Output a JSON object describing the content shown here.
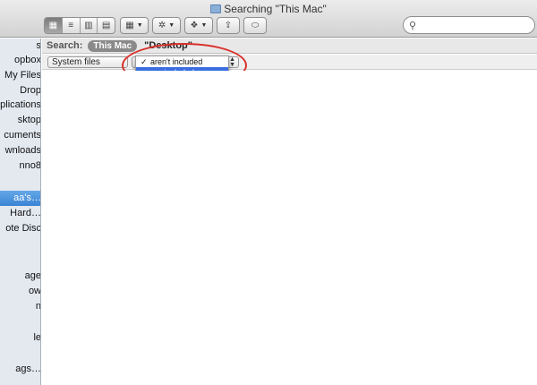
{
  "window": {
    "title": "Searching \"This Mac\""
  },
  "toolbar": {
    "view_buttons": [
      "icon-view",
      "list-view",
      "column-view",
      "coverflow-view"
    ],
    "arrange_icon": "grid-icon",
    "action_icon": "gear-icon",
    "dropbox_icon": "dropbox-icon",
    "share_icon": "share-icon",
    "tag_icon": "tag-icon"
  },
  "search": {
    "placeholder": "",
    "value": ""
  },
  "sidebar": {
    "items": [
      {
        "label": "s",
        "selected": false
      },
      {
        "label": "opbox",
        "selected": false
      },
      {
        "label": "My Files",
        "selected": false
      },
      {
        "label": "Drop",
        "selected": false
      },
      {
        "label": "plications",
        "selected": false
      },
      {
        "label": "sktop",
        "selected": false
      },
      {
        "label": "cuments",
        "selected": false
      },
      {
        "label": "wnloads",
        "selected": false
      },
      {
        "label": "nno8",
        "selected": false
      },
      {
        "label": "",
        "selected": false
      },
      {
        "label": "aa's…",
        "selected": true
      },
      {
        "label": "Hard…",
        "selected": false
      },
      {
        "label": "ote Disc",
        "selected": false
      },
      {
        "label": "",
        "selected": false
      },
      {
        "label": "",
        "selected": false
      },
      {
        "label": "age",
        "selected": false
      },
      {
        "label": "ow",
        "selected": false
      },
      {
        "label": "n",
        "selected": false
      },
      {
        "label": "",
        "selected": false
      },
      {
        "label": "le",
        "selected": false
      },
      {
        "label": "",
        "selected": false
      },
      {
        "label": "ags…",
        "selected": false
      }
    ]
  },
  "searchbar": {
    "label": "Search:",
    "scope_this_mac": "This Mac",
    "scope_desktop": "\"Desktop\""
  },
  "criteria": {
    "attribute": "System files"
  },
  "popup": {
    "options": [
      {
        "label": "aren't included",
        "checked": true,
        "highlighted": false
      },
      {
        "label": "are included",
        "checked": false,
        "highlighted": true
      }
    ]
  },
  "colors": {
    "annotation": "#d9302a",
    "highlight": "#3a6ee0",
    "sidebar_selected": "#3b84d4"
  }
}
